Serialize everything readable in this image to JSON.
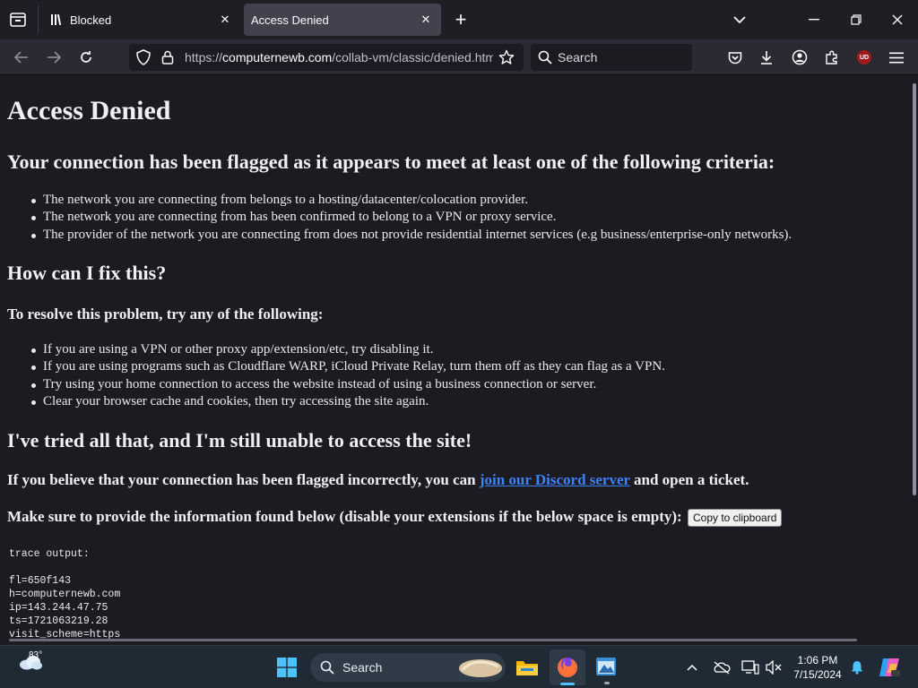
{
  "browser": {
    "tabs": [
      {
        "title": "Blocked",
        "active": false
      },
      {
        "title": "Access Denied",
        "active": true
      }
    ],
    "url_prefix": "https://",
    "url_host": "computernewb.com",
    "url_path": "/collab-vm/classic/denied.html",
    "search_placeholder": "Search",
    "extension_badge": "UD"
  },
  "page": {
    "title": "Access Denied",
    "criteria_heading": "Your connection has been flagged as it appears to meet at least one of the following criteria:",
    "criteria": [
      "The network you are connecting from belongs to a hosting/datacenter/colocation provider.",
      "The network you are connecting from has been confirmed to belong to a VPN or proxy service.",
      "The provider of the network you are connecting from does not provide residential internet services (e.g business/enterprise-only networks)."
    ],
    "fix_heading": "How can I fix this?",
    "resolve_heading": "To resolve this problem, try any of the following:",
    "fixes": [
      "If you are using a VPN or other proxy app/extension/etc, try disabling it.",
      "If you are using programs such as Cloudflare WARP, iCloud Private Relay, turn them off as they can flag as a VPN.",
      "Try using your home connection to access the website instead of using a business connection or server.",
      "Clear your browser cache and cookies, then try accessing the site again."
    ],
    "still_heading": "I've tried all that, and I'm still unable to access the site!",
    "discord_pre": "If you believe that your connection has been flagged incorrectly, you can ",
    "discord_link": "join our Discord server",
    "discord_post": " and open a ticket.",
    "provide_info": "Make sure to provide the information found below (disable your extensions if the below space is empty):",
    "copy_button": "Copy to clipboard",
    "trace_label": "trace output:",
    "trace_lines": [
      "fl=650f143",
      "h=computernewb.com",
      "ip=143.244.47.75",
      "ts=1721063219.28",
      "visit_scheme=https"
    ]
  },
  "taskbar": {
    "weather_temp": "83°",
    "search_label": "Search",
    "time": "1:06 PM",
    "date": "7/15/2024"
  },
  "colors": {
    "page_bg": "#1c1b22",
    "toolbar_bg": "#2b2a33",
    "link": "#3b82f6",
    "taskbar_bg": "#1f2a35"
  }
}
